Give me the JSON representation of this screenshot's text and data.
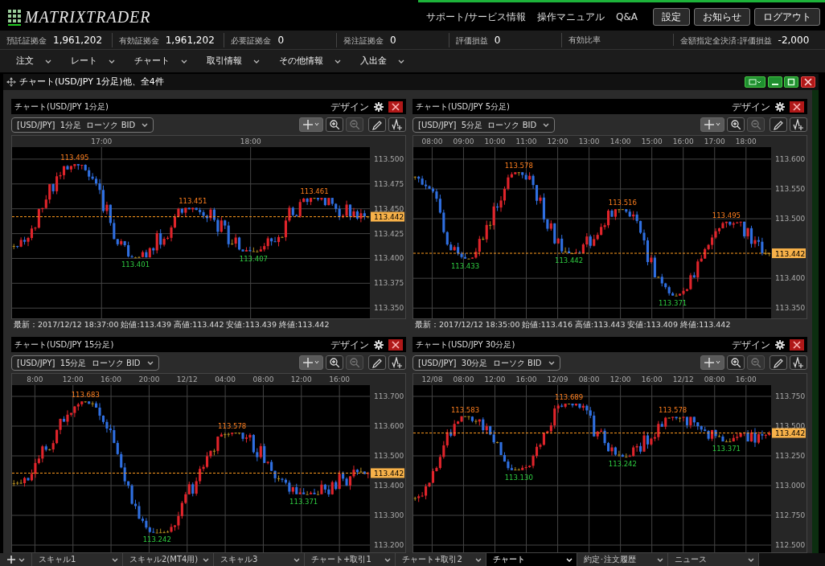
{
  "header": {
    "logo": "MATRIXTRADER",
    "links": [
      "サポート/サービス情報",
      "操作マニュアル",
      "Q&A"
    ],
    "buttons": [
      "設定",
      "お知らせ",
      "ログアウト"
    ]
  },
  "account": [
    {
      "label": "預託証拠金",
      "value": "1,961,202"
    },
    {
      "label": "有効証拠金",
      "value": "1,961,202"
    },
    {
      "label": "必要証拠金",
      "value": "0"
    },
    {
      "label": "発注証拠金",
      "value": "0"
    },
    {
      "label": "評価損益",
      "value": "0"
    },
    {
      "label": "有効比率"
    },
    {
      "label": "金額指定全決済:評価損益",
      "value": "-2,000"
    }
  ],
  "menu": [
    "注文",
    "レート",
    "チャート",
    "取引情報",
    "その他情報",
    "入出金"
  ],
  "window": {
    "title": "チャート(USD/JPY 1分足)他、全4件"
  },
  "charts": [
    {
      "title": "チャート(USD/JPY 1分足)",
      "design": "デザイン",
      "selector": "[USD/JPY]  1分足  ローソク BID",
      "crosshair_selected": true,
      "zoom_out_disabled": true,
      "xticks": [
        "17:00",
        "18:00"
      ],
      "yticks": [
        "113.500",
        "113.475",
        "113.450",
        "113.425",
        "113.400",
        "113.375",
        "113.350"
      ],
      "price": "113.442",
      "annotations": [
        {
          "kind": "high",
          "text": "113.495"
        },
        {
          "kind": "low",
          "text": "113.401"
        },
        {
          "kind": "high",
          "text": "113.451"
        },
        {
          "kind": "low",
          "text": "113.407"
        },
        {
          "kind": "high",
          "text": "113.461"
        }
      ],
      "footer": "最新：2017/12/12 18:37:00 始値:113.439 高値:113.442 安値:113.439 終値:113.442"
    },
    {
      "title": "チャート(USD/JPY 5分足)",
      "design": "デザイン",
      "selector": "[USD/JPY]  5分足  ローソク BID",
      "crosshair_selected": true,
      "zoom_out_disabled": true,
      "xticks": [
        "08:00",
        "09:00",
        "10:00",
        "11:00",
        "12:00",
        "13:00",
        "14:00",
        "15:00",
        "16:00",
        "17:00",
        "18:00"
      ],
      "yticks": [
        "113.600",
        "113.550",
        "113.500",
        "113.400",
        "113.350"
      ],
      "price": "113.442",
      "annotations": [
        {
          "kind": "low",
          "text": "113.433"
        },
        {
          "kind": "high",
          "text": "113.578"
        },
        {
          "kind": "low",
          "text": "113.442"
        },
        {
          "kind": "high",
          "text": "113.516"
        },
        {
          "kind": "low",
          "text": "113.371"
        },
        {
          "kind": "high",
          "text": "113.495"
        }
      ],
      "footer": "最新：2017/12/12 18:35:00 始値:113.416 高値:113.443 安値:113.409 終値:113.442"
    },
    {
      "title": "チャート(USD/JPY 15分足)",
      "design": "デザイン",
      "selector": "[USD/JPY]  15分足  ローソク BID",
      "crosshair_selected": true,
      "zoom_out_disabled": true,
      "xticks": [
        "8:00",
        "12:00",
        "16:00",
        "20:00",
        "12/12",
        "04:00",
        "08:00",
        "12:00",
        "16:00"
      ],
      "yticks": [
        "113.700",
        "113.600",
        "113.500",
        "113.400",
        "113.300",
        "113.200"
      ],
      "price": "113.442",
      "annotations": [
        {
          "kind": "high",
          "text": "113.683"
        },
        {
          "kind": "low",
          "text": "113.242"
        },
        {
          "kind": "high",
          "text": "113.578"
        },
        {
          "kind": "low",
          "text": "113.371"
        }
      ]
    },
    {
      "title": "チャート(USD/JPY 30分足)",
      "design": "デザイン",
      "selector": "[USD/JPY]  30分足  ローソク BID",
      "crosshair_selected": true,
      "zoom_out_disabled": true,
      "xticks": [
        "12/08",
        "08:00",
        "12:00",
        "16:00",
        "12/09",
        "08:00",
        "12:00",
        "16:00",
        "12/12",
        "08:00",
        "16:00"
      ],
      "yticks": [
        "113.750",
        "113.500",
        "113.250",
        "113.000",
        "112.750",
        "112.500"
      ],
      "price": "113.442",
      "annotations": [
        {
          "kind": "high",
          "text": "113.583"
        },
        {
          "kind": "low",
          "text": "113.130"
        },
        {
          "kind": "high",
          "text": "113.689"
        },
        {
          "kind": "low",
          "text": "113.242"
        },
        {
          "kind": "high",
          "text": "113.578"
        },
        {
          "kind": "low",
          "text": "113.371"
        }
      ]
    }
  ],
  "tabs": [
    {
      "label": "スキャル1",
      "selected": false
    },
    {
      "label": "スキャル2(MT4用)",
      "selected": false
    },
    {
      "label": "スキャル3",
      "selected": false
    },
    {
      "label": "チャート+取引1",
      "selected": false
    },
    {
      "label": "チャート+取引2",
      "selected": false
    },
    {
      "label": "チャート",
      "selected": true
    },
    {
      "label": "約定･注文履歴",
      "selected": false
    },
    {
      "label": "ニュース",
      "selected": false
    }
  ]
}
